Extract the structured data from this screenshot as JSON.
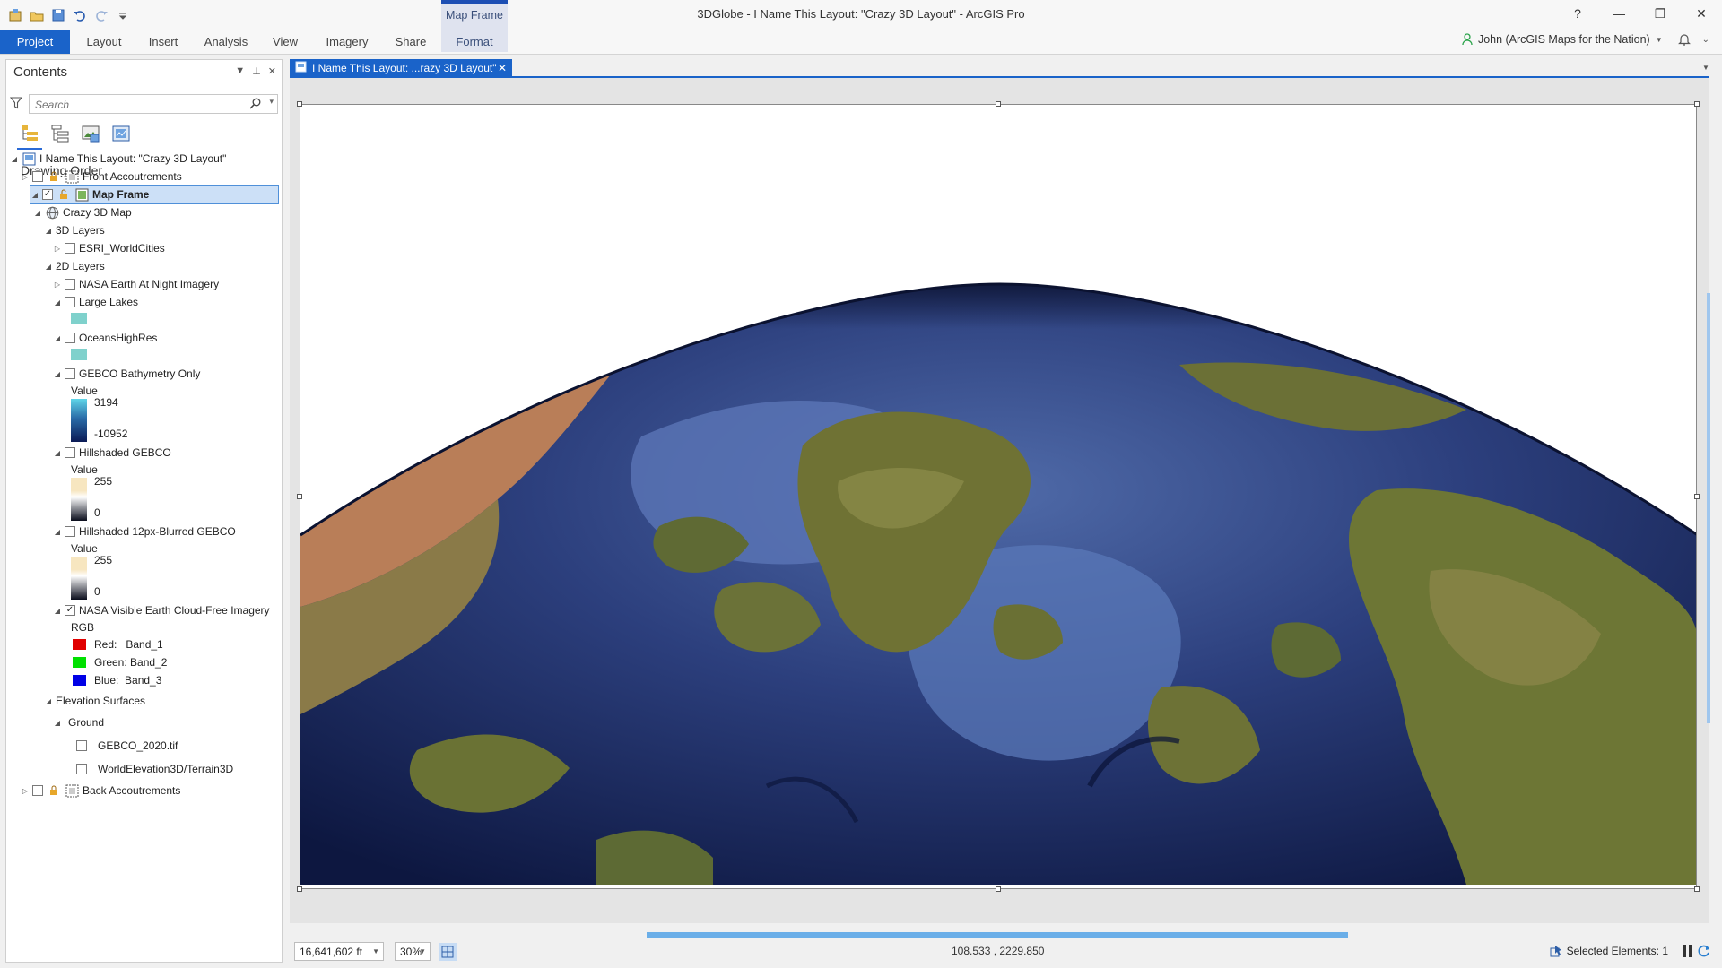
{
  "window": {
    "title": "3DGlobe - I Name This Layout: \"Crazy 3D Layout\" - ArcGIS Pro",
    "context_tab_group": "Map Frame",
    "controls": [
      "?",
      "—",
      "❐",
      "✕"
    ]
  },
  "ribbon": {
    "tabs": [
      "Project",
      "Layout",
      "Insert",
      "Analysis",
      "View",
      "Imagery",
      "Share",
      "Format"
    ],
    "active": "Project"
  },
  "user": {
    "name": "John (ArcGIS Maps for the Nation)"
  },
  "contents": {
    "title": "Contents",
    "search_placeholder": "Search",
    "section": "Drawing Order",
    "layout_name": "I Name This Layout: \"Crazy 3D Layout\"",
    "front_accoutrements": "Front Accoutrements",
    "map_frame": "Map Frame",
    "map_name": "Crazy 3D Map",
    "group_3d": "3D Layers",
    "esri_worldcities": "ESRI_WorldCities",
    "group_2d": "2D Layers",
    "nasa_night": "NASA Earth At Night Imagery",
    "large_lakes": "Large Lakes",
    "oceans": "OceansHighRes",
    "gebco_bathy": "GEBCO Bathymetry Only",
    "gebco_value_label": "Value",
    "gebco_max": "3194",
    "gebco_min": "-10952",
    "hillshaded": "Hillshaded GEBCO",
    "hillshaded_value_label": "Value",
    "hillshaded_max": "255",
    "hillshaded_min": "0",
    "hillshaded_blur": "Hillshaded 12px-Blurred GEBCO",
    "blur_value_label": "Value",
    "blur_max": "255",
    "blur_min": "0",
    "nasa_visible": "NASA Visible Earth Cloud-Free Imagery",
    "rgb_label": "RGB",
    "red": "Red:   Band_1",
    "green": "Green: Band_2",
    "blue": "Blue:  Band_3",
    "elevation_surfaces": "Elevation Surfaces",
    "ground": "Ground",
    "gebco_tif": "GEBCO_2020.tif",
    "world_elevation": "WorldElevation3D/Terrain3D",
    "back_accoutrements": "Back Accoutrements",
    "colors": {
      "lake": "#7fd1cc",
      "ocean": "#7fd1cc",
      "red": "#e00000",
      "green": "#00e000",
      "blue": "#0000e6"
    }
  },
  "layout_view": {
    "tab_label": "I Name This Layout: ...razy 3D Layout\""
  },
  "status": {
    "scale": "16,641,602 ft",
    "zoom": "30%",
    "coords": "108.533 , 2229.850",
    "selected": "Selected Elements: 1"
  }
}
